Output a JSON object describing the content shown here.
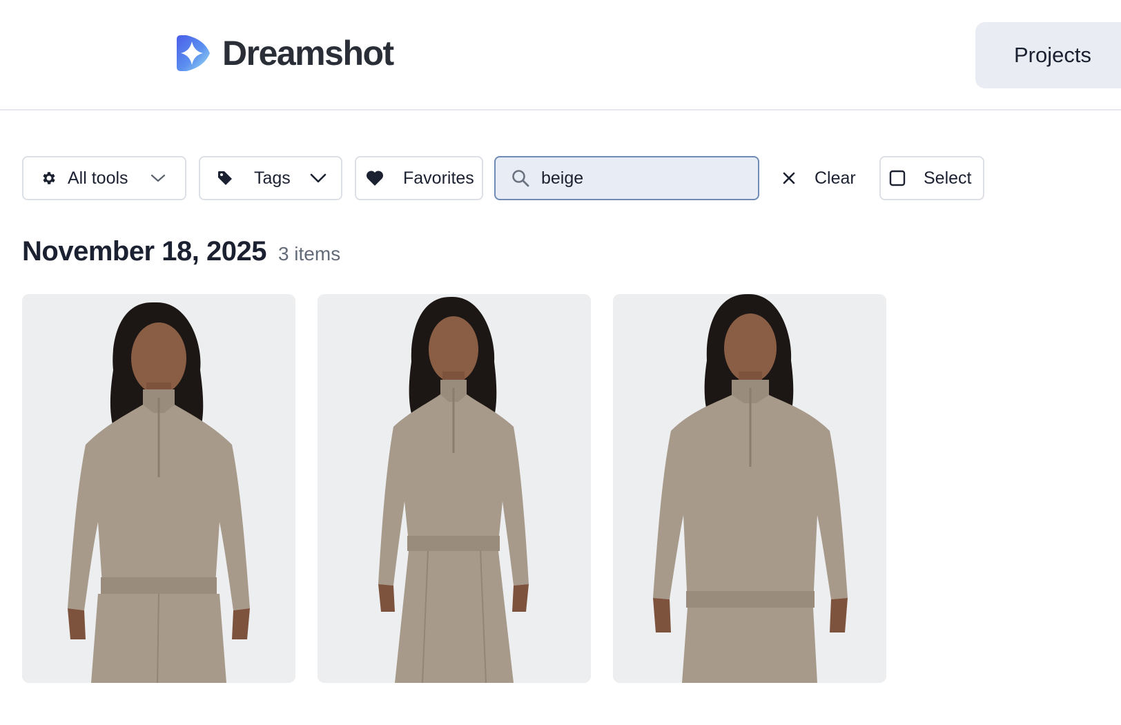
{
  "app": {
    "brand_name": "Dreamshot",
    "logo_icon": "sparkle-star-logo"
  },
  "header": {
    "projects_label": "Projects"
  },
  "toolbar": {
    "tools_filter": {
      "label": "All tools",
      "icon": "gear-icon"
    },
    "tags_filter": {
      "label": "Tags",
      "icon": "tag-icon"
    },
    "favorites": {
      "label": "Favorites",
      "icon": "heart-icon"
    },
    "search": {
      "value": "beige",
      "placeholder": ""
    },
    "clear_label": "Clear",
    "select_label": "Select"
  },
  "gallery": {
    "groups": [
      {
        "date": "November 18, 2025",
        "count_label": "3 items",
        "items": [
          {
            "pose": "front-view-1"
          },
          {
            "pose": "front-view-2"
          },
          {
            "pose": "front-view-3"
          }
        ]
      }
    ]
  },
  "colors": {
    "accent": "#5b7fe0",
    "search_bg": "#e8ecf4",
    "search_border": "#6f8bb5",
    "garment": "#a89a8a",
    "photo_bg": "#eceef0"
  }
}
